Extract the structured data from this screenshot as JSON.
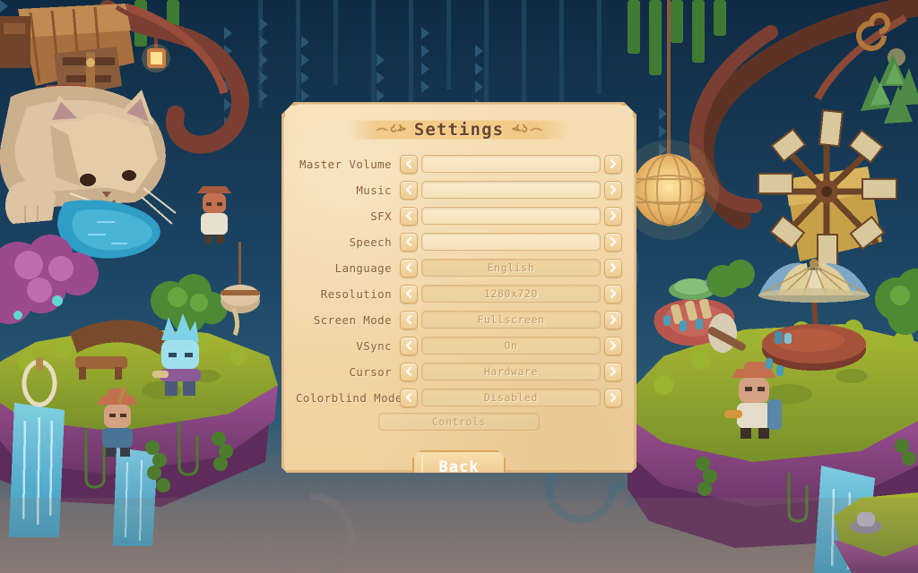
{
  "window": {
    "title": "Settings"
  },
  "panel": {
    "title": "Settings",
    "left_ornament": "swirl-ornament-left",
    "right_ornament": "swirl-ornament-right",
    "prev_icon": "chevron-left-icon",
    "next_icon": "chevron-right-icon"
  },
  "rows": [
    {
      "label": "Master Volume",
      "type": "slider",
      "value": "",
      "fill_percent": 0
    },
    {
      "label": "Music",
      "type": "slider",
      "value": "",
      "fill_percent": 0
    },
    {
      "label": "SFX",
      "type": "slider",
      "value": "",
      "fill_percent": 0
    },
    {
      "label": "Speech",
      "type": "slider",
      "value": "",
      "fill_percent": 0
    },
    {
      "label": "Language",
      "type": "value",
      "value": "English"
    },
    {
      "label": "Resolution",
      "type": "value",
      "value": "1280x720"
    },
    {
      "label": "Screen Mode",
      "type": "value",
      "value": "Fullscreen"
    },
    {
      "label": "VSync",
      "type": "value",
      "value": "On"
    },
    {
      "label": "Cursor",
      "type": "value",
      "value": "Hardware"
    },
    {
      "label": "Colorblind Mode",
      "type": "value",
      "value": "Disabled"
    }
  ],
  "controls": {
    "label": "Controls"
  },
  "back": {
    "label": "Back",
    "selected": true
  },
  "colors": {
    "panel_bg": "#f3d6a4",
    "panel_border": "#e0b97f",
    "label_text": "#8a6038",
    "value_text": "#c49a63",
    "title_text": "#6b4526",
    "back_text": "#ffffff",
    "sky": "#123049",
    "grass": "#8ea02b",
    "rock": "#8e4a86",
    "water": "#49b4d6"
  },
  "background": {
    "description": "pixel-art fantasy scene with floating islands",
    "elements": [
      "giant-cat",
      "wagon",
      "hanging-lantern",
      "windmill",
      "parasol-umbrella",
      "waterfall",
      "floating-island",
      "vines",
      "characters",
      "spiral-motif"
    ]
  }
}
